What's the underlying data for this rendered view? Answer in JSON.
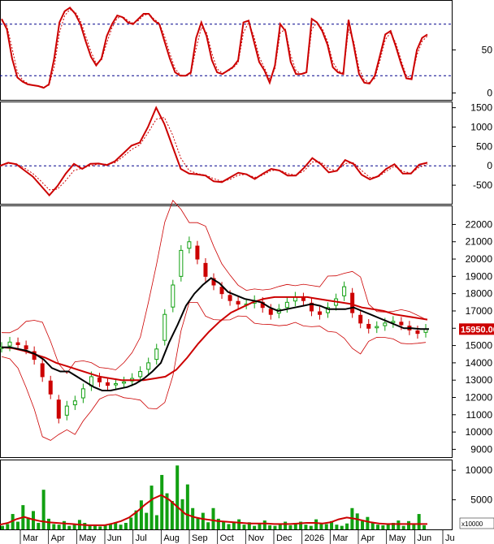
{
  "chart_data": {
    "type": "line",
    "months": [
      "Mar",
      "Apr",
      "May",
      "Jun",
      "Jul",
      "Aug",
      "Sep",
      "Oct",
      "Nov",
      "Dec",
      "2026",
      "Mar",
      "Apr",
      "May",
      "Jun",
      "Ju"
    ],
    "panels": [
      {
        "id": "stochastic",
        "yticks": [
          "50",
          "0"
        ],
        "ytick_values": [
          50,
          0
        ],
        "ylim": [
          -8,
          108
        ],
        "reference_lines": [
          80,
          20
        ],
        "series": [
          {
            "role": "k",
            "values": [
              86,
              74,
              40,
              18,
              13,
              10,
              9,
              8,
              6,
              10,
              40,
              82,
              95,
              99,
              92,
              80,
              60,
              42,
              32,
              40,
              66,
              80,
              90,
              88,
              82,
              80,
              86,
              92,
              92,
              84,
              80,
              60,
              40,
              24,
              20,
              20,
              24,
              64,
              82,
              66,
              38,
              24,
              22,
              26,
              30,
              38,
              82,
              84,
              60,
              36,
              26,
              12,
              32,
              80,
              72,
              36,
              22,
              22,
              24,
              86,
              82,
              72,
              56,
              30,
              24,
              22,
              85,
              55,
              22,
              12,
              11,
              20,
              44,
              68,
              72,
              54,
              34,
              17,
              16,
              50,
              64,
              68
            ]
          },
          {
            "role": "d",
            "values": [
              84,
              78,
              52,
              24,
              15,
              11,
              9,
              8,
              7,
              9,
              30,
              70,
              90,
              97,
              94,
              84,
              66,
              48,
              34,
              38,
              58,
              76,
              87,
              89,
              84,
              81,
              84,
              90,
              92,
              86,
              81,
              66,
              46,
              28,
              21,
              20,
              22,
              52,
              76,
              70,
              46,
              28,
              23,
              25,
              29,
              35,
              70,
              82,
              66,
              42,
              29,
              16,
              28,
              70,
              74,
              44,
              26,
              22,
              23,
              74,
              82,
              75,
              60,
              36,
              26,
              23,
              74,
              60,
              28,
              15,
              12,
              17,
              38,
              62,
              70,
              58,
              38,
              20,
              17,
              44,
              60,
              66
            ]
          }
        ]
      },
      {
        "id": "macd",
        "yticks": [
          "1500",
          "1000",
          "500",
          "0",
          "-500"
        ],
        "ytick_values": [
          1500,
          1000,
          500,
          0,
          -500
        ],
        "ylim": [
          -980,
          1660
        ],
        "reference_lines": [
          0
        ],
        "series": [
          {
            "role": "macd",
            "values": [
              0,
              80,
              40,
              -120,
              -280,
              -520,
              -760,
              -520,
              -200,
              50,
              -80,
              50,
              60,
              20,
              120,
              320,
              520,
              600,
              1000,
              1500,
              1080,
              500,
              -80,
              -200,
              -220,
              -250,
              -400,
              -420,
              -300,
              -180,
              -220,
              -340,
              -200,
              -80,
              -120,
              -250,
              -250,
              -50,
              200,
              50,
              -170,
              -130,
              150,
              50,
              -230,
              -350,
              -270,
              -80,
              40,
              -200,
              -200,
              30,
              80
            ]
          },
          {
            "role": "signal",
            "values": [
              0,
              60,
              50,
              -60,
              -200,
              -400,
              -620,
              -600,
              -380,
              -120,
              -60,
              0,
              40,
              40,
              80,
              240,
              420,
              540,
              850,
              1200,
              1250,
              800,
              200,
              -120,
              -200,
              -240,
              -330,
              -400,
              -350,
              -240,
              -220,
              -300,
              -240,
              -120,
              -110,
              -200,
              -240,
              -130,
              100,
              100,
              -80,
              -130,
              60,
              80,
              -120,
              -300,
              -290,
              -140,
              -10,
              -140,
              -190,
              -40,
              40
            ]
          }
        ]
      },
      {
        "id": "price",
        "yticks": [
          "22000",
          "21000",
          "20000",
          "19000",
          "18000",
          "17000",
          "16000",
          "15000",
          "14000",
          "13000",
          "12000",
          "11000",
          "10000",
          "9000"
        ],
        "ytick_values": [
          22000,
          21000,
          20000,
          19000,
          18000,
          17000,
          16000,
          15000,
          14000,
          13000,
          12000,
          11000,
          10000,
          9000
        ],
        "ylim": [
          8550,
          23100
        ],
        "last_price": "15950.00",
        "last_price_value": 15950,
        "ma_short": [
          14900,
          14900,
          14800,
          14700,
          14500,
          14200,
          13700,
          13500,
          13500,
          13200,
          12900,
          12600,
          12400,
          12400,
          12500,
          12600,
          12800,
          13100,
          13500,
          14000,
          15200,
          16200,
          17300,
          18000,
          18500,
          18900,
          18600,
          18100,
          17900,
          17700,
          17600,
          17500,
          17200,
          17000,
          17100,
          17200,
          17300,
          17400,
          17300,
          17100,
          17100,
          17100,
          17200,
          17000,
          16800,
          16600,
          16400,
          16200,
          16000,
          16000,
          15950,
          15950
        ],
        "ma_long": [
          14900,
          14850,
          14700,
          14500,
          14300,
          14000,
          13800,
          13600,
          13400,
          13200,
          13100,
          13000,
          13000,
          13000,
          13100,
          13200,
          13600,
          14300,
          15100,
          15800,
          16400,
          16900,
          17200,
          17500,
          17700,
          17800,
          17800,
          17800,
          17800,
          17700,
          17600,
          17500,
          17400,
          17200,
          17100,
          17000,
          16800,
          16700,
          16600,
          16500
        ],
        "candles": [
          14900,
          15200,
          15050,
          14800,
          14200,
          13200,
          12200,
          10800,
          11500,
          11800,
          12500,
          13200,
          12900,
          12700,
          12800,
          12900,
          13100,
          13500,
          14000,
          14800,
          16800,
          18500,
          20500,
          21000,
          20000,
          19000,
          18500,
          18000,
          17600,
          17400,
          17400,
          17600,
          17200,
          16800,
          17100,
          17500,
          17800,
          17600,
          17000,
          16800,
          17200,
          17700,
          18400,
          16900,
          16300,
          16000,
          16100,
          16300,
          16400,
          16200,
          15900,
          15700,
          15950
        ]
      },
      {
        "id": "volume",
        "yticks": [
          "10000",
          "5000"
        ],
        "ytick_values": [
          10000,
          5000
        ],
        "ylim": [
          0,
          11800
        ],
        "multiplier_label": "x10000",
        "ma_volume": [
          800,
          1100,
          1700,
          2100,
          1700,
          1400,
          1200,
          1100,
          1000,
          900,
          800,
          700,
          700,
          700,
          1000,
          1400,
          2000,
          3000,
          4200,
          5200,
          5800,
          5000,
          3800,
          2600,
          2100,
          1800,
          1600,
          1400,
          1300,
          1200,
          1100,
          1000,
          1000,
          1000,
          900,
          900,
          900,
          1000,
          1100,
          1100,
          1000,
          1200,
          1700,
          2000,
          1800,
          1500,
          1200,
          1000,
          900,
          900,
          900,
          900,
          900,
          900
        ],
        "bars": [
          600,
          900,
          2600,
          1300,
          4100,
          2000,
          3100,
          1100,
          6700,
          1800,
          900,
          800,
          1400,
          600,
          900,
          1600,
          1100,
          800,
          600,
          500,
          700,
          900,
          1200,
          800,
          1100,
          2000,
          3200,
          4900,
          2800,
          7400,
          2400,
          9200,
          6100,
          4800,
          10800,
          5100,
          7600,
          3600,
          1900,
          2800,
          1200,
          3600,
          1800,
          1400,
          900,
          1100,
          1700,
          800,
          1200,
          600,
          900,
          1500,
          700,
          600,
          900,
          1300,
          700,
          1100,
          1300,
          800,
          600,
          1700,
          1100,
          900,
          1400,
          800,
          600,
          1000,
          3600,
          2700,
          1400,
          2100,
          1200,
          800,
          700,
          900,
          1100,
          1500,
          600,
          1400,
          800,
          2600,
          700
        ]
      }
    ]
  }
}
